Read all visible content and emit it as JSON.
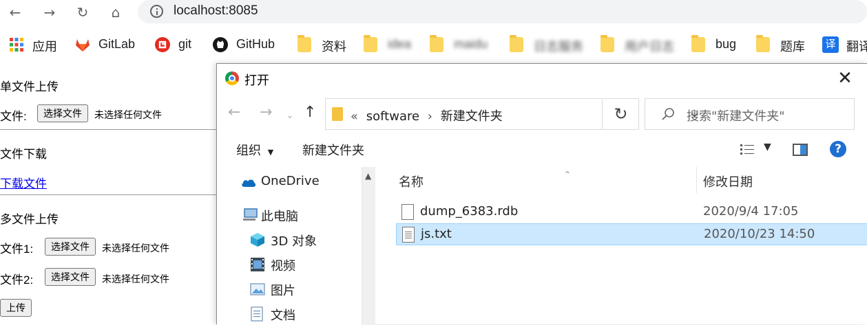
{
  "browser": {
    "url": "localhost:8085",
    "icons": {
      "back": "arrow-left-icon",
      "forward": "arrow-right-icon",
      "reload": "reload-icon",
      "home": "home-icon",
      "info": "info-icon"
    }
  },
  "bookmarks": [
    {
      "label": "应用",
      "icon": "apps-grid-icon"
    },
    {
      "label": "GitLab",
      "icon": "gitlab-icon"
    },
    {
      "label": "git",
      "icon": "git-icon"
    },
    {
      "label": "GitHub",
      "icon": "github-icon"
    },
    {
      "label": "资料",
      "icon": "folder-icon"
    },
    {
      "label": "idea",
      "icon": "folder-icon"
    },
    {
      "label": "maidu",
      "icon": "folder-icon"
    },
    {
      "label": "日志服务",
      "icon": "folder-icon"
    },
    {
      "label": "用户日志",
      "icon": "folder-icon"
    },
    {
      "label": "bug",
      "icon": "folder-icon"
    },
    {
      "label": "题库",
      "icon": "folder-icon"
    },
    {
      "label": "翻译",
      "icon": "translate-icon"
    }
  ],
  "page": {
    "single_upload_title": "单文件上传",
    "file_label": "文件:",
    "choose_file": "选择文件",
    "no_file": "未选择任何文件",
    "download_title": "文件下载",
    "download_link": "下载文件",
    "multi_upload_title": "多文件上传",
    "file1_label": "文件1:",
    "file2_label": "文件2:",
    "upload_button": "上传"
  },
  "dialog": {
    "title": "打开",
    "breadcrumb_prefix": "«",
    "breadcrumb": [
      "software",
      "新建文件夹"
    ],
    "search_placeholder": "搜索\"新建文件夹\"",
    "organize": "组织",
    "new_folder": "新建文件夹",
    "nav_items": [
      {
        "label": "OneDrive",
        "icon": "onedrive-icon"
      },
      {
        "label": "此电脑",
        "icon": "computer-icon"
      },
      {
        "label": "3D 对象",
        "icon": "3d-objects-icon"
      },
      {
        "label": "视频",
        "icon": "video-icon"
      },
      {
        "label": "图片",
        "icon": "pictures-icon"
      },
      {
        "label": "文档",
        "icon": "documents-icon"
      }
    ],
    "columns": {
      "name": "名称",
      "modified": "修改日期"
    },
    "files": [
      {
        "name": "dump_6383.rdb",
        "modified": "2020/9/4 17:05",
        "selected": false
      },
      {
        "name": "js.txt",
        "modified": "2020/10/23 14:50",
        "selected": true
      }
    ]
  },
  "colors": {
    "selection": "#cce8ff",
    "link": "#0000ee",
    "help": "#1e6fd0",
    "folder": "#fbd55d"
  }
}
